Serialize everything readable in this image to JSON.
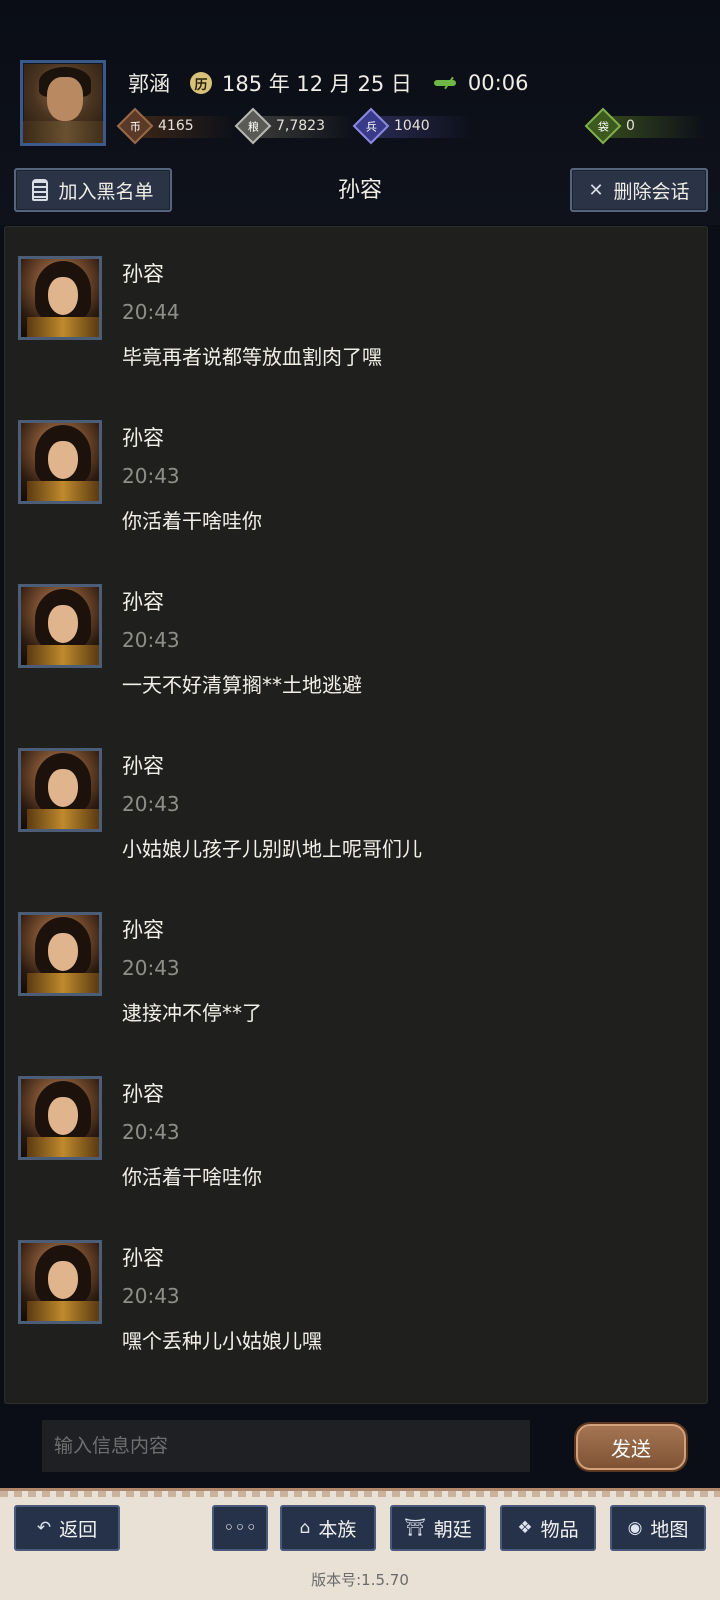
{
  "player": {
    "name": "郭涵",
    "date": "185 年 12 月 25 日",
    "clock": "00:06"
  },
  "resources": [
    {
      "icon": "coin-icon",
      "value": "4165",
      "color": "#8a5a3a"
    },
    {
      "icon": "grain-icon",
      "value": "7,7823",
      "color": "#8a8a86"
    },
    {
      "icon": "soldier-icon",
      "value": "1040",
      "color": "#6a6ab8"
    },
    {
      "icon": "pouch-icon",
      "value": "0",
      "color": "#5f8a2e"
    }
  ],
  "header": {
    "block_label": "加入黑名单",
    "title": "孙容",
    "delete_label": "删除会话"
  },
  "messages": [
    {
      "sender": "孙容",
      "time": "20:44",
      "text": "毕竟再者说都等放血割肉了嘿"
    },
    {
      "sender": "孙容",
      "time": "20:43",
      "text": "你活着干啥哇你"
    },
    {
      "sender": "孙容",
      "time": "20:43",
      "text": "一天不好清算搁**土地逃避"
    },
    {
      "sender": "孙容",
      "time": "20:43",
      "text": "小姑娘儿孩子儿别趴地上呢哥们儿"
    },
    {
      "sender": "孙容",
      "time": "20:43",
      "text": "逮接冲不停**了"
    },
    {
      "sender": "孙容",
      "time": "20:43",
      "text": "你活着干啥哇你"
    },
    {
      "sender": "孙容",
      "time": "20:43",
      "text": "嘿个丢种儿小姑娘儿嘿"
    }
  ],
  "composer": {
    "placeholder": "输入信息内容",
    "value": "",
    "send_label": "发送"
  },
  "nav": {
    "back": "返回",
    "more": "◦◦◦",
    "clan": "本族",
    "court": "朝廷",
    "items": "物品",
    "map": "地图"
  },
  "version": "版本号:1.5.70"
}
